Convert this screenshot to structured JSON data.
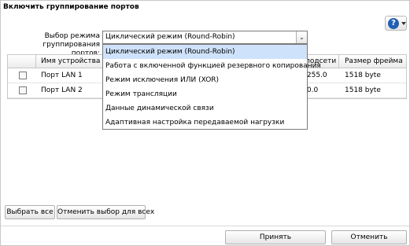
{
  "title": "Включить группирование портов",
  "help": {
    "glyph": "?"
  },
  "mode": {
    "label": "Выбор режима группирования портов:",
    "selected": "Циклический режим (Round-Robin)",
    "arrow": "⌄",
    "options": [
      "Циклический режим (Round-Robin)",
      "Работа с включенной функцией резервного копирования",
      "Режим исключения ИЛИ (XOR)",
      "Режим трансляции",
      "Данные динамической связи",
      "Адаптивная настройка передаваемой нагрузки"
    ]
  },
  "table": {
    "headers": {
      "device": "Имя устройства",
      "subnet": "подсети",
      "frame": "Размер фрейма"
    },
    "rows": [
      {
        "name": "Порт LAN 1",
        "subnet": ".255.0",
        "frame": "1518 byte"
      },
      {
        "name": "Порт LAN 2",
        "subnet": ".0.0",
        "frame": "1518 byte"
      }
    ]
  },
  "buttons": {
    "select_all": "Выбрать все",
    "deselect_all": "Отменить выбор для всех",
    "apply": "Принять",
    "cancel": "Отменить"
  }
}
